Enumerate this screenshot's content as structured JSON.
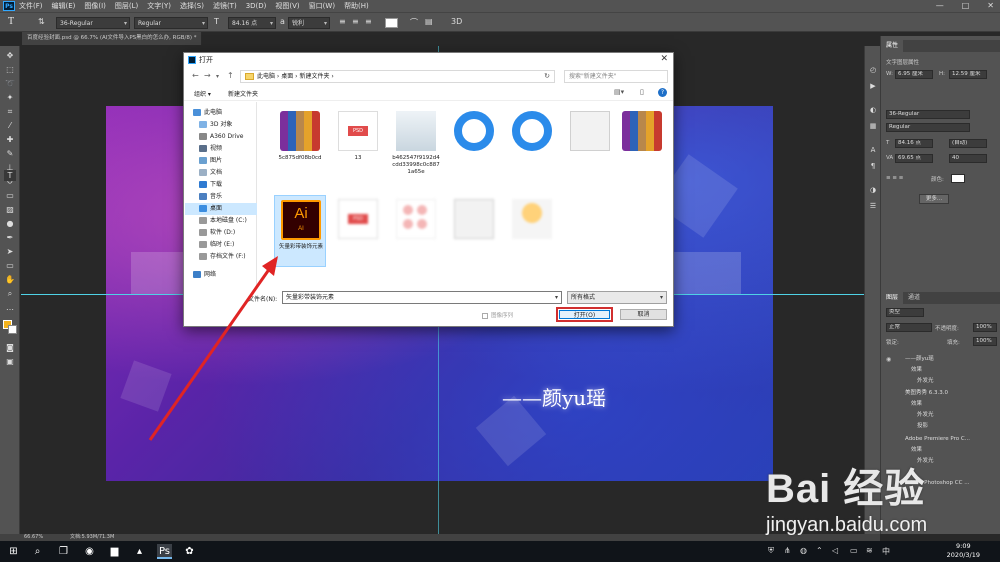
{
  "menubar": {
    "items": [
      "文件(F)",
      "编辑(E)",
      "图像(I)",
      "图层(L)",
      "文字(Y)",
      "选择(S)",
      "滤镜(T)",
      "3D(D)",
      "视图(V)",
      "窗口(W)",
      "帮助(H)"
    ],
    "win_min": "—",
    "win_max": "□",
    "win_close": "✕"
  },
  "optbar": {
    "tool_glyph": "T",
    "font_family": "36-Regular",
    "font_style": "Regular",
    "font_size": "84.16 点",
    "antialias": "锐利",
    "mode_3d": "3D"
  },
  "doc_tab": {
    "title": "百度经验封面.psd @ 66.7% (AI文件导入PS黑白的怎么办, RGB/8) *"
  },
  "canvas": {
    "text": "——颜yu瑶"
  },
  "character_panel": {
    "tab": "属性",
    "section": "文字图层属性",
    "tracking_label": "VA",
    "w_value": "6.95 厘米",
    "h_value": "12.59 厘米",
    "font": "36-Regular",
    "style": "Regular",
    "size": "84.16 点",
    "leading": "(自动)",
    "scale": "69.65 点",
    "kerning": "40",
    "color_label": "颜色:",
    "more_button": "更多..."
  },
  "layers_panel": {
    "tabs": [
      "图层",
      "通道"
    ],
    "filter": "类型",
    "blend": "正常",
    "opacity_label": "不透明度:",
    "opacity": "100%",
    "lock_label": "锁定:",
    "fill_label": "填充:",
    "fill": "100%",
    "layers": [
      "——颜yu瑶",
      "效果",
      "外发光",
      "美图秀秀 6.3.3.0",
      "效果",
      "外发光",
      "投影",
      "Adobe Premiere Pro C...",
      "效果",
      "外发光",
      "Adobe Photoshop CC ..."
    ]
  },
  "status": {
    "zoom": "66.67%",
    "doc": "文档:5.93M/71.3M"
  },
  "dialog": {
    "title": "打开",
    "path": [
      "此电脑",
      "桌面",
      "新建文件夹"
    ],
    "search_placeholder": "搜索\"新建文件夹\"",
    "organize": "组织 ▾",
    "new_folder": "新建文件夹",
    "sidebar": [
      "此电脑",
      "3D 对象",
      "A360 Drive",
      "视频",
      "图片",
      "文档",
      "下载",
      "音乐",
      "桌面",
      "本地磁盘 (C:)",
      "软件 (D:)",
      "临时 (E:)",
      "存档文件 (F:)",
      "网络"
    ],
    "files": [
      "5c875df08b0cd",
      "13",
      "b462547f9192d4cdd33998c0c8871a65e",
      "",
      "",
      "",
      "",
      "矢量彩带装饰元素",
      "",
      "",
      "",
      ""
    ],
    "filename_label": "文件名(N):",
    "filename": "矢量彩带装饰元素",
    "filetype": "所有格式",
    "seq_label": "图像序列",
    "open_button": "打开(O)",
    "cancel_button": "取消"
  },
  "taskbar": {
    "time": "9:09",
    "date": "2020/3/19"
  },
  "watermark": {
    "logo": "Bai 经验",
    "url": "jingyan.baidu.com"
  },
  "colors": {
    "ps_panel": "#535353",
    "foreground": "#f5b41e",
    "accent_red": "#d12f2f",
    "selection": "#cce8ff"
  }
}
